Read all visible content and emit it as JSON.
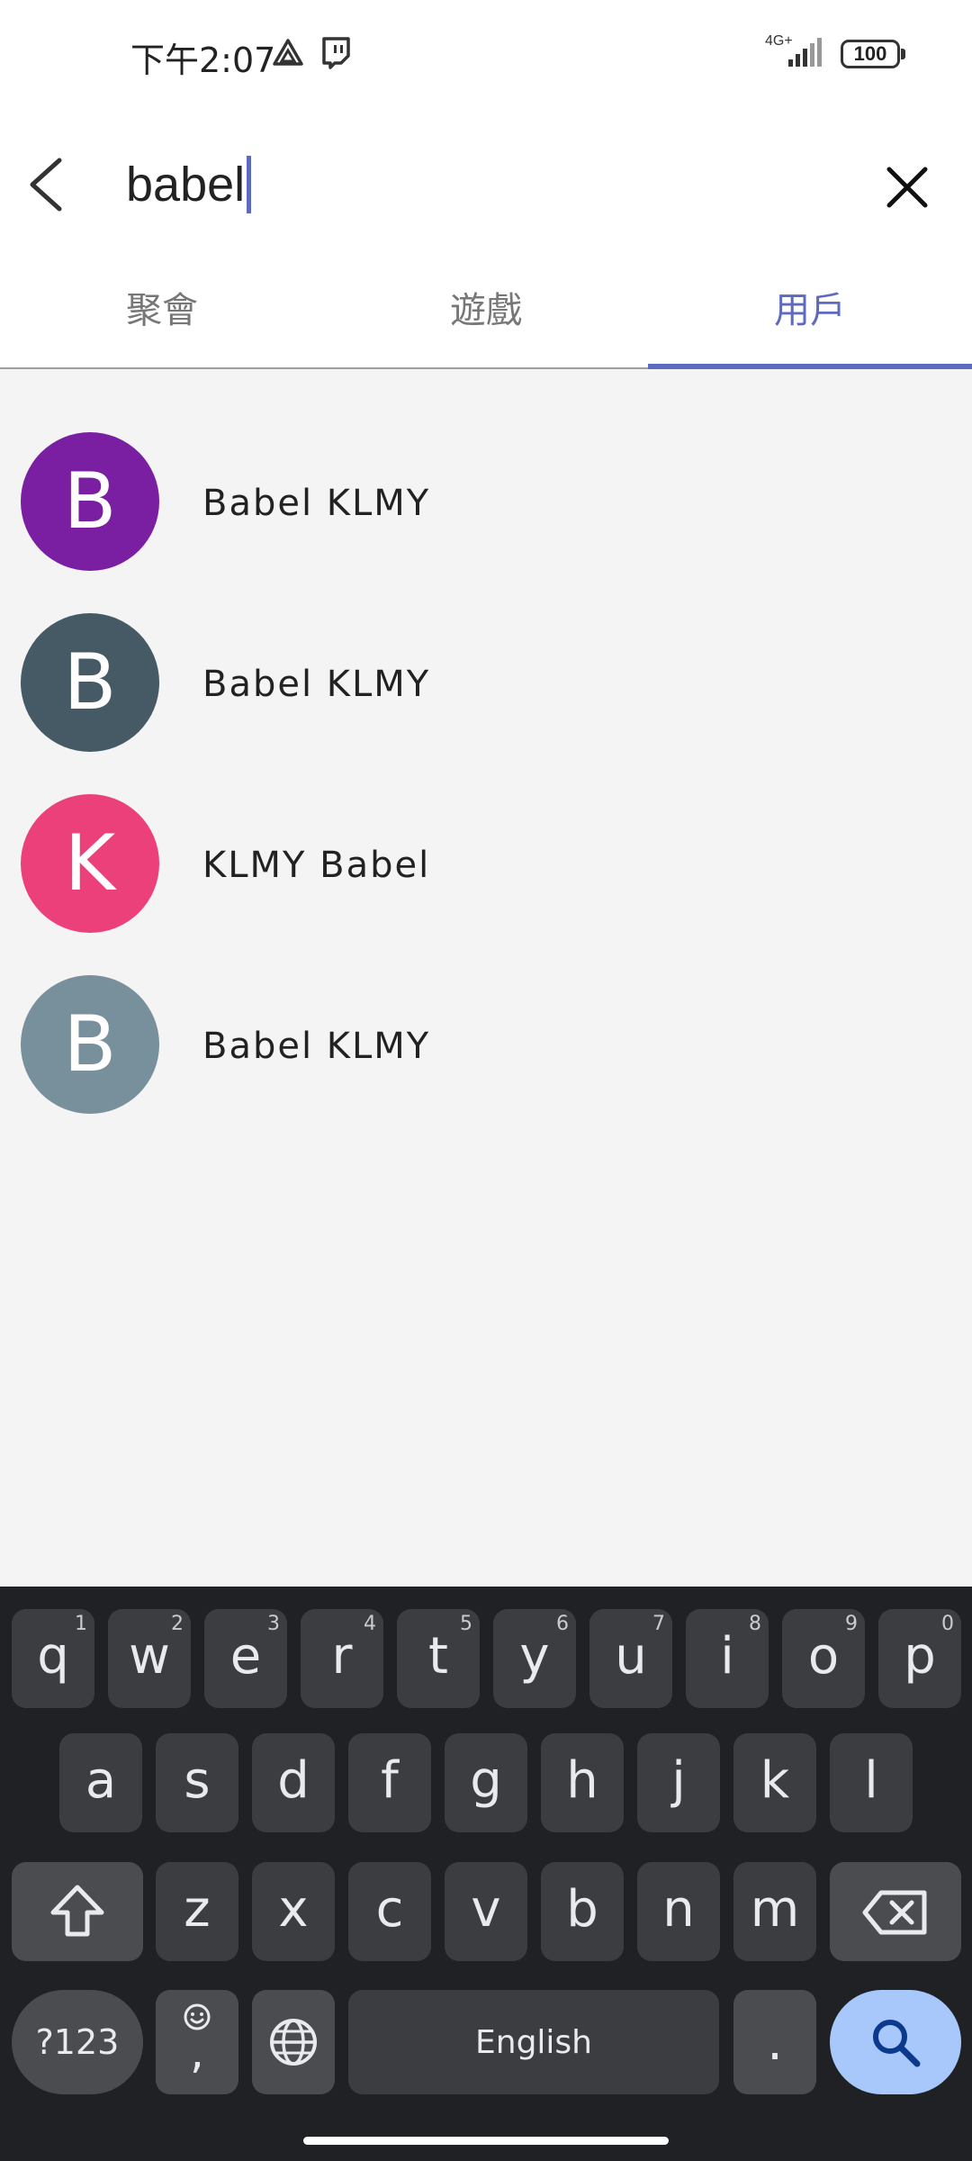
{
  "status_bar": {
    "time": "下午2:07",
    "network": "4G+",
    "battery": "100"
  },
  "search": {
    "query": "babel"
  },
  "tabs": [
    {
      "label": "聚會",
      "active": false
    },
    {
      "label": "遊戲",
      "active": false
    },
    {
      "label": "用戶",
      "active": true
    }
  ],
  "results": [
    {
      "initial": "B",
      "name": "Babel KLMY",
      "color": "#7b1fa2"
    },
    {
      "initial": "B",
      "name": "Babel KLMY",
      "color": "#455a64"
    },
    {
      "initial": "K",
      "name": "KLMY Babel",
      "color": "#ec407a"
    },
    {
      "initial": "B",
      "name": "Babel KLMY",
      "color": "#78909c"
    }
  ],
  "keyboard": {
    "row1": [
      {
        "key": "q",
        "hint": "1"
      },
      {
        "key": "w",
        "hint": "2"
      },
      {
        "key": "e",
        "hint": "3"
      },
      {
        "key": "r",
        "hint": "4"
      },
      {
        "key": "t",
        "hint": "5"
      },
      {
        "key": "y",
        "hint": "6"
      },
      {
        "key": "u",
        "hint": "7"
      },
      {
        "key": "i",
        "hint": "8"
      },
      {
        "key": "o",
        "hint": "9"
      },
      {
        "key": "p",
        "hint": "0"
      }
    ],
    "row2": [
      "a",
      "s",
      "d",
      "f",
      "g",
      "h",
      "j",
      "k",
      "l"
    ],
    "row3": [
      "z",
      "x",
      "c",
      "v",
      "b",
      "n",
      "m"
    ],
    "symbols_label": "?123",
    "comma_label": ",",
    "space_label": "English",
    "period_label": "."
  },
  "colors": {
    "accent": "#5c6bc0",
    "keyboard_bg": "#202124",
    "key_bg": "#3c3d41",
    "search_key_bg": "#a8c7fa"
  }
}
